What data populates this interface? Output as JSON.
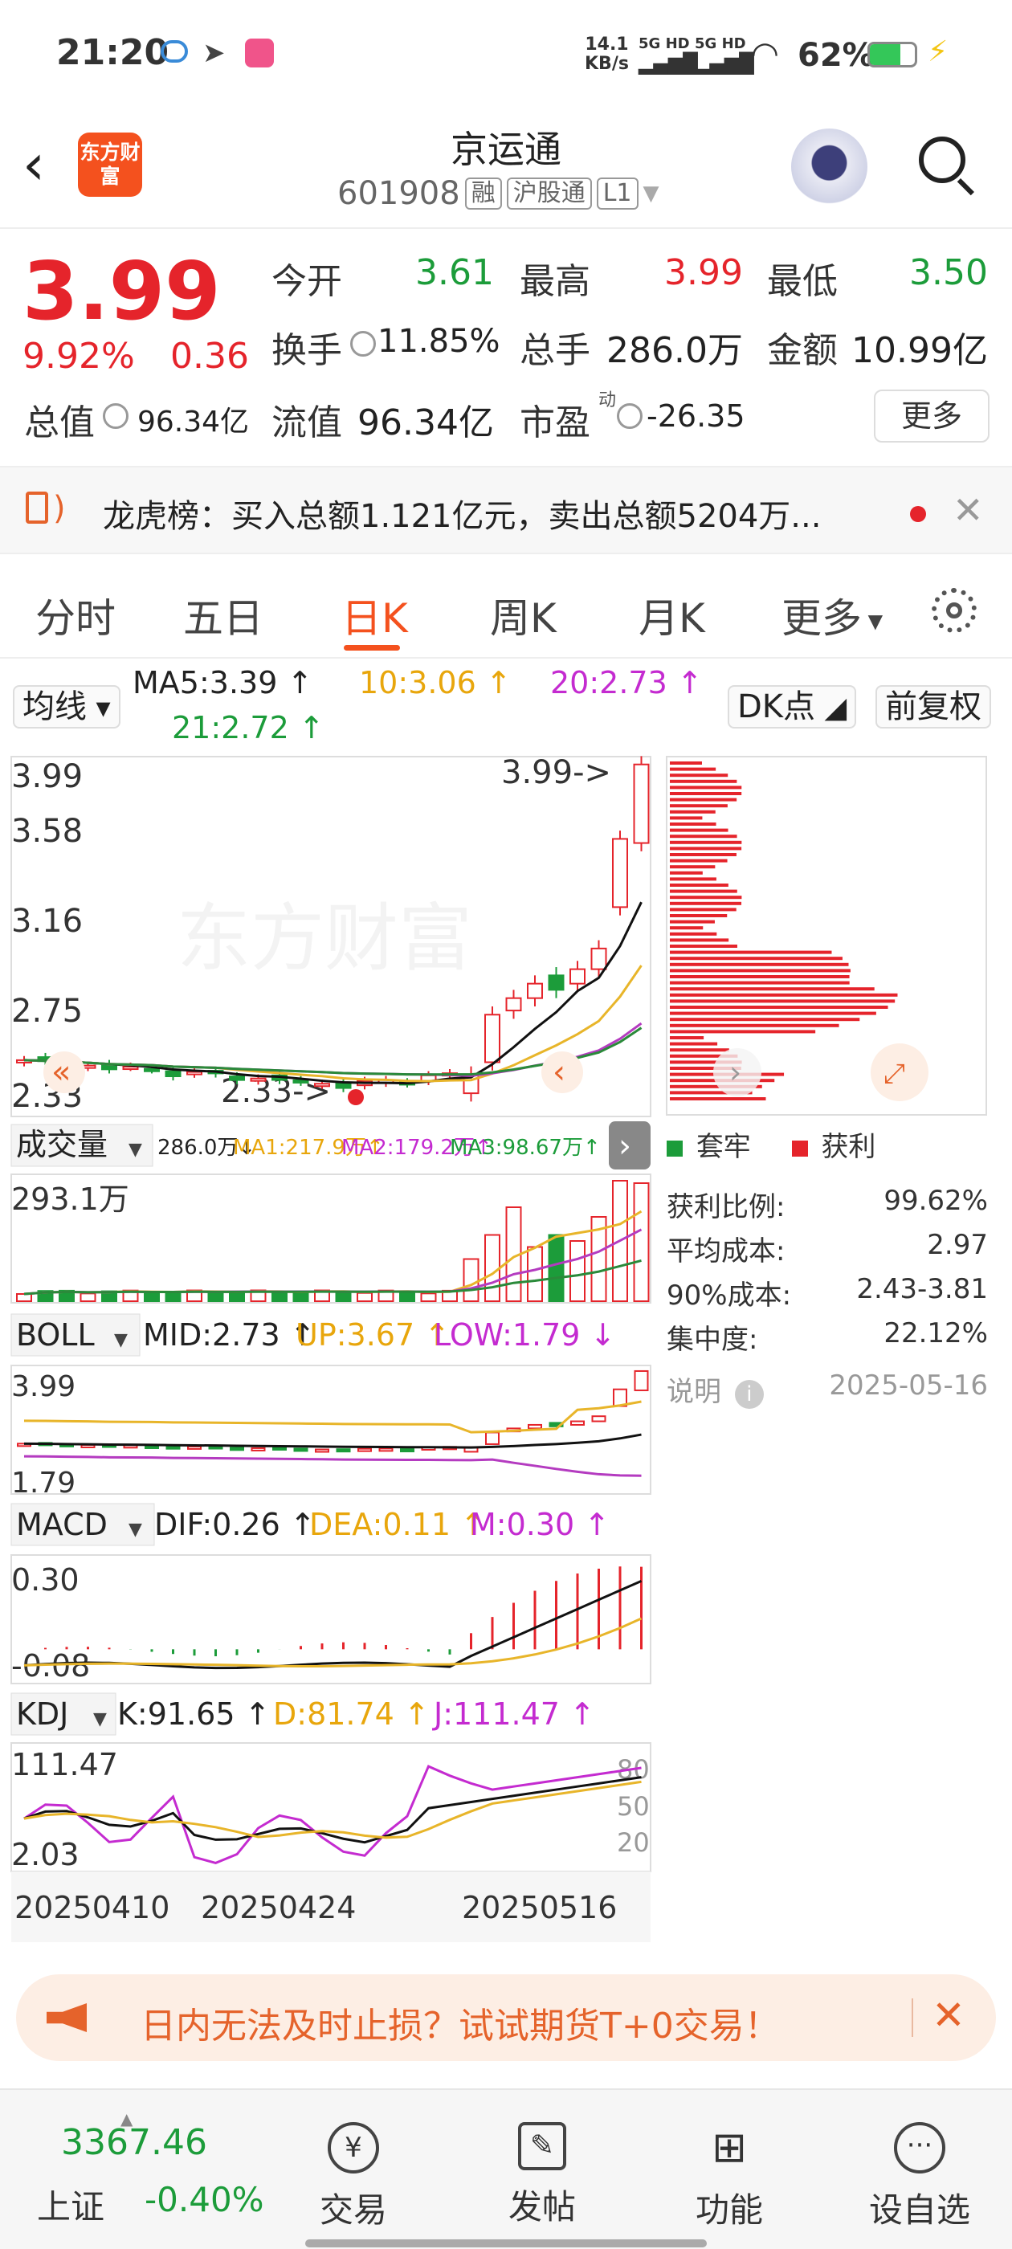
{
  "status_bar": {
    "time": "21:20",
    "net_speed": "14.1",
    "net_unit": "KB/s",
    "sig1": "5G HD",
    "sig2": "5G HD",
    "battery": "62%"
  },
  "header": {
    "title": "京运通",
    "code": "601908",
    "tags": [
      "融",
      "沪股通",
      "L1"
    ],
    "logo_text": "东方财富"
  },
  "quote": {
    "price": "3.99",
    "change_pct": "9.92%",
    "change": "0.36",
    "open_label": "今开",
    "open": "3.61",
    "high_label": "最高",
    "high": "3.99",
    "low_label": "最低",
    "low": "3.50",
    "turnover_label": "换手",
    "turnover": "11.85%",
    "volume_label": "总手",
    "volume": "286.0万",
    "amount_label": "金额",
    "amount": "10.99亿",
    "mcap_label": "总值",
    "mcap": "96.34亿",
    "float_label": "流值",
    "float": "96.34亿",
    "pe_label": "市盈",
    "pe_sup": "动",
    "pe": "-26.35",
    "more_label": "更多"
  },
  "notice": {
    "text": "龙虎榜：买入总额1.121亿元，卖出总额5204万..."
  },
  "tabs": [
    "分时",
    "五日",
    "日K",
    "周K",
    "月K",
    "更多"
  ],
  "active_tab": "日K",
  "ma": {
    "selector": "均线",
    "ma5": "MA5:3.39 ↑",
    "ma10": "10:3.06 ↑",
    "ma20": "20:2.73 ↑",
    "ma21": "21:2.72 ↑",
    "dk": "DK点",
    "adjust": "前复权"
  },
  "kline": {
    "ytop": "3.99",
    "y2": "3.58",
    "y3": "3.16",
    "y4": "2.75",
    "ybot": "2.33",
    "max_label": "3.99->",
    "min_label": "2.33->",
    "watermark": "东方财富"
  },
  "volume": {
    "selector": "成交量",
    "vol": "286.0万↓",
    "ma1": "MA1:217.9万↑",
    "ma2": "MA2:179.2万↑",
    "ma3": "MA3:98.67万↑",
    "ymax": "293.1万"
  },
  "boll": {
    "selector": "BOLL",
    "mid": "MID:2.73 ↑",
    "up": "UP:3.67 ↑",
    "low": "LOW:1.79 ↓",
    "ytop": "3.99",
    "ybot": "1.79"
  },
  "macd": {
    "selector": "MACD",
    "dif": "DIF:0.26 ↑",
    "dea": "DEA:0.11 ↑",
    "m": "M:0.30 ↑",
    "ytop": "0.30",
    "ybot": "-0.08"
  },
  "kdj": {
    "selector": "KDJ",
    "k": "K:91.65 ↑",
    "d": "D:81.74 ↑",
    "j": "J:111.47 ↑",
    "ytop": "111.47",
    "ybot": "2.03",
    "r80": "80",
    "r50": "50",
    "r20": "20"
  },
  "dates": [
    "20250410",
    "20250424",
    "20250516"
  ],
  "chips": {
    "legend_trap": "套牢",
    "legend_profit": "获利",
    "profit_ratio_label": "获利比例:",
    "profit_ratio": "99.62%",
    "avg_cost_label": "平均成本:",
    "avg_cost": "2.97",
    "cost90_label": "90%成本:",
    "cost90": "2.43-3.81",
    "concentration_label": "集中度:",
    "concentration": "22.12%",
    "note_label": "说明",
    "date": "2025-05-16"
  },
  "promo": {
    "text": "日内无法及时止损？试试期货T+0交易！"
  },
  "bottom_nav": {
    "index_value": "3367.46",
    "index_name": "上证",
    "index_change": "-0.40%",
    "trade": "交易",
    "post": "发帖",
    "functions": "功能",
    "watchlist": "设自选"
  },
  "colors": {
    "up": "#e5242b",
    "down": "#1c9c3a",
    "ma10": "#e8a60c",
    "ma20": "#c42bd0",
    "brand": "#f4511e"
  }
}
